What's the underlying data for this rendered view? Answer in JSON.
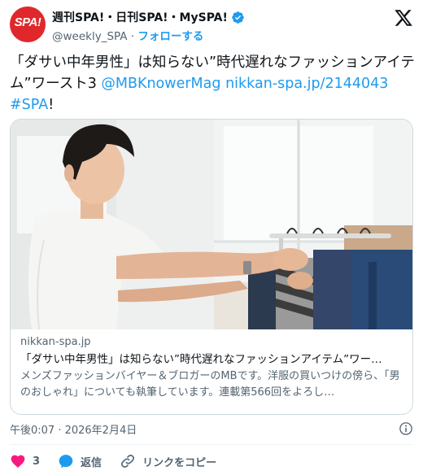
{
  "account": {
    "display_name": "週刊SPA!・日刊SPA!・MySPA!",
    "handle": "@weekly_SPA",
    "separator": " · ",
    "follow_label": "フォローする",
    "avatar_text": "SPA!"
  },
  "tweet": {
    "text_plain": "「ダサい中年男性」は知らない”時代遅れなファッションアイテム”ワースト3 ",
    "mention": "@MBKnowerMag",
    "url": "nikkan-spa.jp/2144043",
    "hashtag": "#SPA",
    "trailing": "!"
  },
  "card": {
    "domain": "nikkan-spa.jp",
    "title": "「ダサい中年男性」は知らない”時代遅れなファッションアイテム”ワー…",
    "description": "メンズファッションバイヤー＆ブロガーのMBです。洋服の買いつけの傍ら、「男のおしゃれ」についても執筆しています。連載第566回をよろし…"
  },
  "timestamp": "午後0:07 · 2026年2月4日",
  "actions": {
    "like_count": "3",
    "reply_label": "返信",
    "copy_link_label": "リンクをコピー"
  },
  "colors": {
    "brand_red": "#e0282c",
    "link_blue": "#1d9bf0",
    "like_pink": "#f91880",
    "muted": "#536471"
  },
  "icons": [
    "verified-badge-icon",
    "x-logo-icon",
    "info-icon",
    "heart-icon",
    "reply-icon",
    "link-icon"
  ]
}
